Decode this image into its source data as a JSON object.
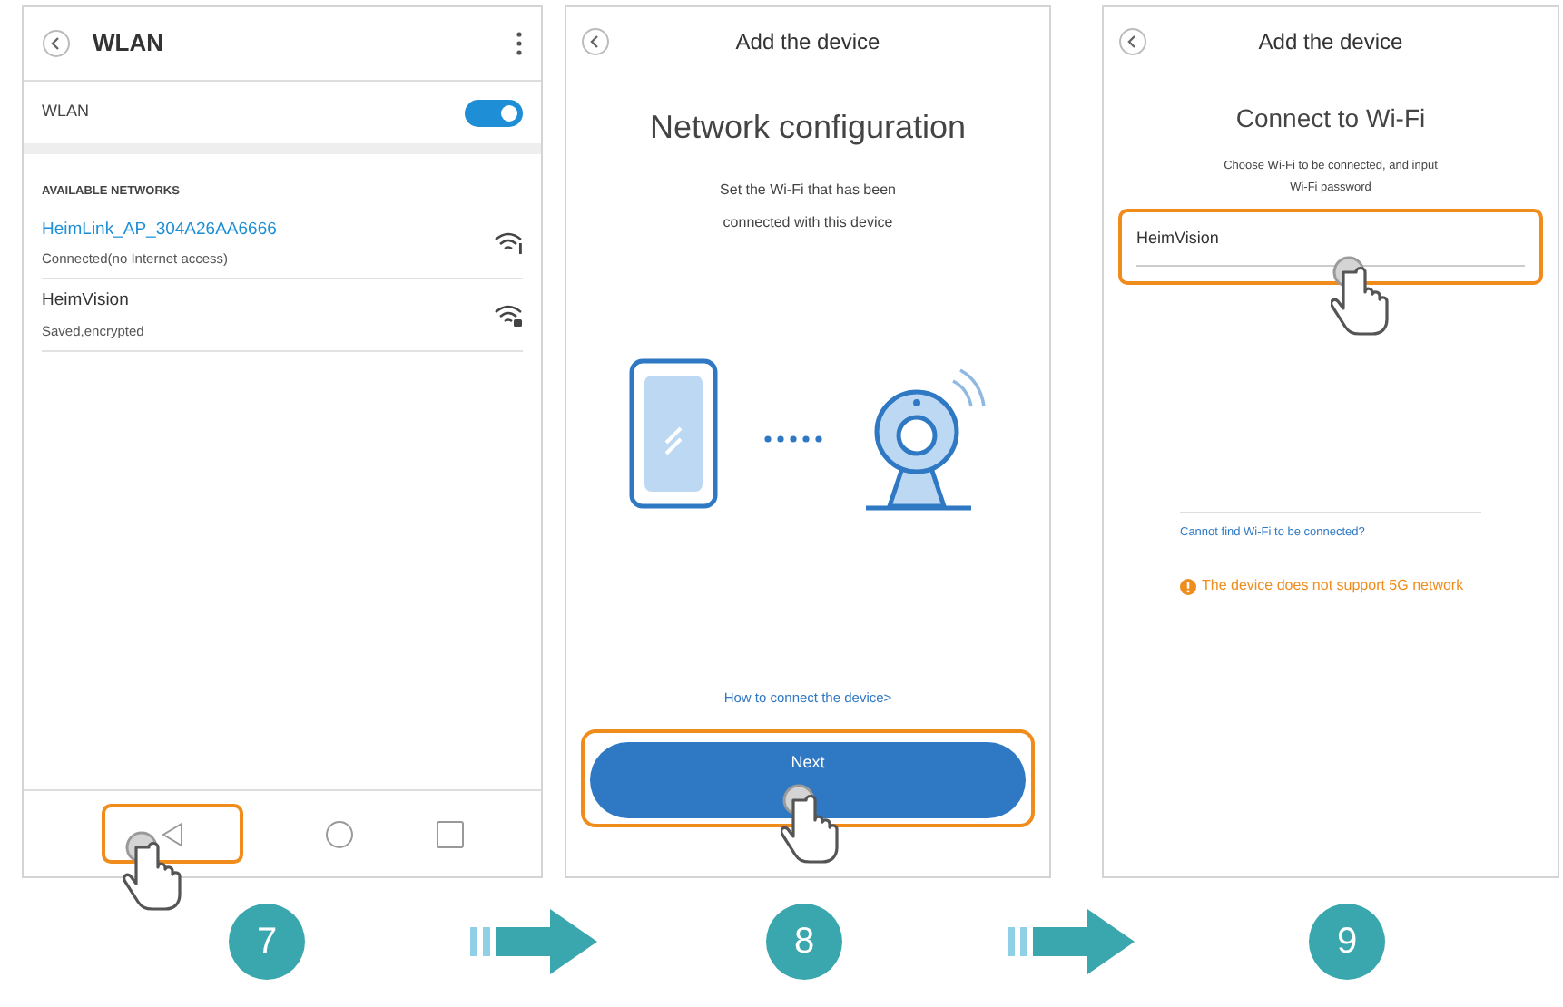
{
  "screens": [
    {
      "kind": "wlan",
      "title": "WLAN",
      "toggle_label": "WLAN",
      "wlan_on": true,
      "section": "AVAILABLE NETWORKS",
      "networks": [
        {
          "name": "HeimLink_AP_304A26AA6666",
          "status": "Connected(no Internet access)",
          "connected": true,
          "locked": false
        },
        {
          "name": "HeimVision",
          "status": "Saved,encrypted",
          "connected": false,
          "locked": true
        }
      ]
    },
    {
      "kind": "config",
      "title": "Add the device",
      "heading": "Network configuration",
      "description": "Set the Wi-Fi that has been connected with this device",
      "link": "How to connect the device>",
      "button": "Next"
    },
    {
      "kind": "wifi",
      "title": "Add the device",
      "heading": "Connect to Wi-Fi",
      "description": "Choose Wi-Fi to be connected, and input Wi-Fi password",
      "ssid": "HeimVision",
      "link": "Cannot find Wi-Fi to be connected?",
      "warning": "The device does not support 5G network"
    }
  ],
  "steps": [
    "7",
    "8",
    "9"
  ]
}
